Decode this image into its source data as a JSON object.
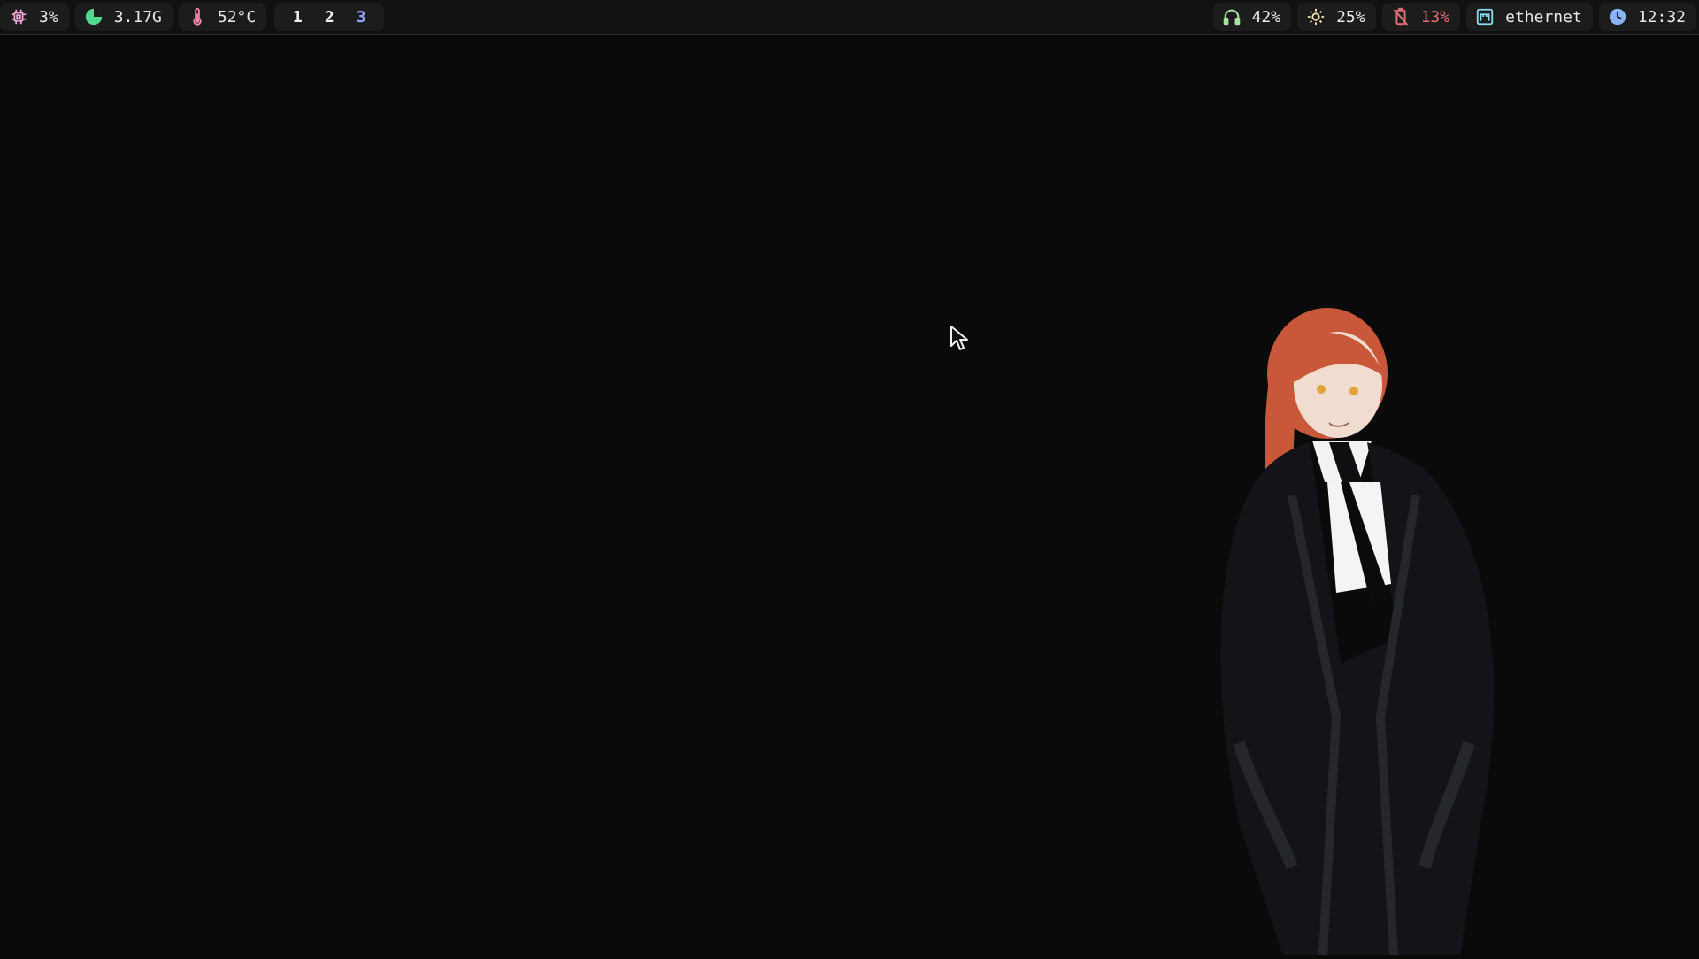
{
  "topbar": {
    "left": {
      "cpu": {
        "icon": "cpu-icon",
        "value": "3%"
      },
      "memory": {
        "icon": "memory-pie-icon",
        "value": "3.17G"
      },
      "temperature": {
        "icon": "thermometer-icon",
        "value": "52°C"
      },
      "workspaces": [
        {
          "label": "1",
          "active": false
        },
        {
          "label": "2",
          "active": false
        },
        {
          "label": "3",
          "active": true
        }
      ]
    },
    "right": {
      "volume": {
        "icon": "headphones-icon",
        "value": "42%"
      },
      "brightness": {
        "icon": "brightness-icon",
        "value": "25%"
      },
      "battery": {
        "icon": "battery-low-icon",
        "value": "13%",
        "color": "#e06c75"
      },
      "network": {
        "icon": "ethernet-icon",
        "value": "ethernet"
      },
      "clock": {
        "icon": "clock-icon",
        "value": "12:32"
      }
    }
  },
  "colors": {
    "background": "#0a0a0a",
    "bar": "#111111",
    "pill": "#1c1c1c",
    "cpu_icon": "#f5a3d7",
    "memory_icon": "#50d890",
    "temperature_icon": "#f38ba8",
    "workspace_active": "#8ea4ff",
    "volume_icon": "#a6e3a1",
    "brightness_icon": "#f9e2af",
    "battery": "#e06c75",
    "network_icon": "#89dceb",
    "clock_icon": "#89b4fa",
    "hair": "#c9583b"
  },
  "desktop": {
    "wallpaper_subject": "anime-character-wallpaper"
  }
}
